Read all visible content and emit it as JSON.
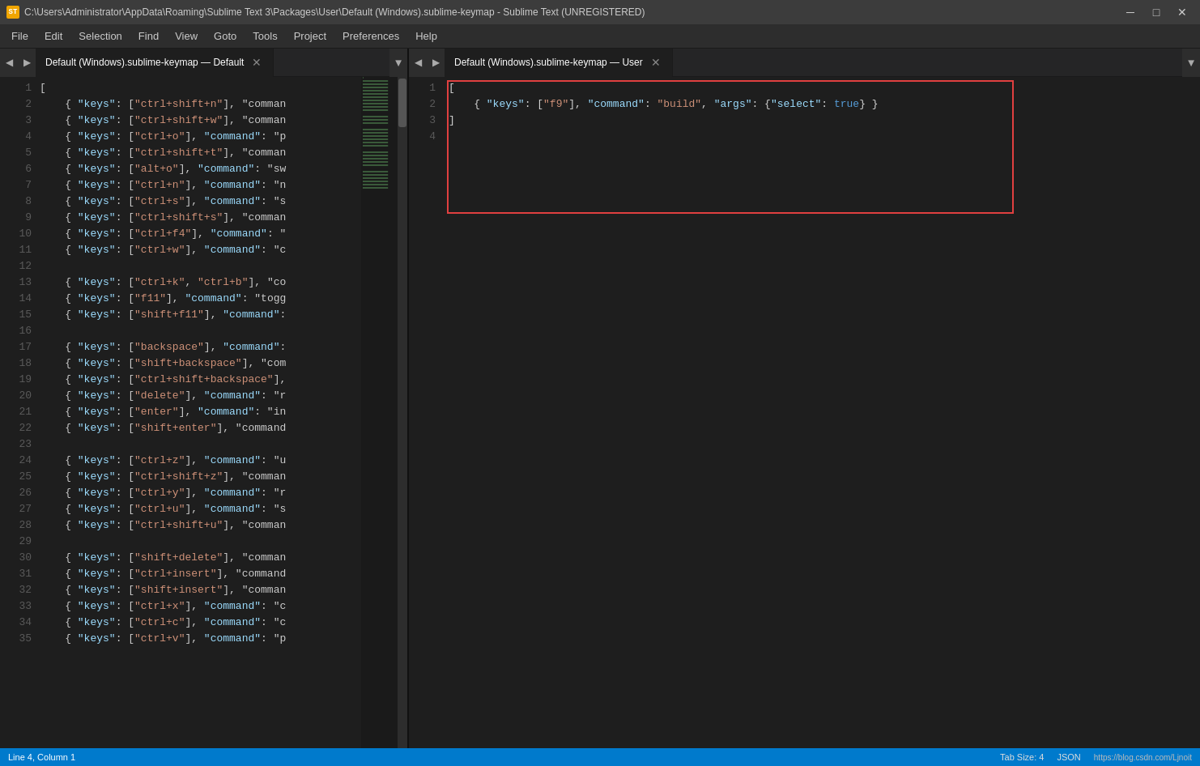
{
  "titlebar": {
    "icon": "ST",
    "text": "C:\\Users\\Administrator\\AppData\\Roaming\\Sublime Text 3\\Packages\\User\\Default (Windows).sublime-keymap - Sublime Text (UNREGISTERED)",
    "minimize": "─",
    "maximize": "□",
    "close": "✕"
  },
  "menubar": {
    "items": [
      "File",
      "Edit",
      "Selection",
      "Find",
      "View",
      "Goto",
      "Tools",
      "Project",
      "Preferences",
      "Help"
    ]
  },
  "left_pane": {
    "tab": {
      "label": "Default (Windows).sublime-keymap — Default",
      "close": "✕"
    },
    "lines": [
      {
        "num": "1",
        "code": "["
      },
      {
        "num": "2",
        "code": "    { \"keys\": [\"ctrl+shift+n\"], \"comman"
      },
      {
        "num": "3",
        "code": "    { \"keys\": [\"ctrl+shift+w\"], \"comman"
      },
      {
        "num": "4",
        "code": "    { \"keys\": [\"ctrl+o\"], \"command\": \"p"
      },
      {
        "num": "5",
        "code": "    { \"keys\": [\"ctrl+shift+t\"], \"comman"
      },
      {
        "num": "6",
        "code": "    { \"keys\": [\"alt+o\"], \"command\": \"sw"
      },
      {
        "num": "7",
        "code": "    { \"keys\": [\"ctrl+n\"], \"command\": \"n"
      },
      {
        "num": "8",
        "code": "    { \"keys\": [\"ctrl+s\"], \"command\": \"s"
      },
      {
        "num": "9",
        "code": "    { \"keys\": [\"ctrl+shift+s\"], \"comman"
      },
      {
        "num": "10",
        "code": "    { \"keys\": [\"ctrl+f4\"], \"command\": \""
      },
      {
        "num": "11",
        "code": "    { \"keys\": [\"ctrl+w\"], \"command\": \"c"
      },
      {
        "num": "12",
        "code": ""
      },
      {
        "num": "13",
        "code": "    { \"keys\": [\"ctrl+k\", \"ctrl+b\"], \"co"
      },
      {
        "num": "14",
        "code": "    { \"keys\": [\"f11\"], \"command\": \"togg"
      },
      {
        "num": "15",
        "code": "    { \"keys\": [\"shift+f11\"], \"command\":"
      },
      {
        "num": "16",
        "code": ""
      },
      {
        "num": "17",
        "code": "    { \"keys\": [\"backspace\"], \"command\":"
      },
      {
        "num": "18",
        "code": "    { \"keys\": [\"shift+backspace\"], \"com"
      },
      {
        "num": "19",
        "code": "    { \"keys\": [\"ctrl+shift+backspace\"],"
      },
      {
        "num": "20",
        "code": "    { \"keys\": [\"delete\"], \"command\": \"r"
      },
      {
        "num": "21",
        "code": "    { \"keys\": [\"enter\"], \"command\": \"in"
      },
      {
        "num": "22",
        "code": "    { \"keys\": [\"shift+enter\"], \"command"
      },
      {
        "num": "23",
        "code": ""
      },
      {
        "num": "24",
        "code": "    { \"keys\": [\"ctrl+z\"], \"command\": \"u"
      },
      {
        "num": "25",
        "code": "    { \"keys\": [\"ctrl+shift+z\"], \"comman"
      },
      {
        "num": "26",
        "code": "    { \"keys\": [\"ctrl+y\"], \"command\": \"r"
      },
      {
        "num": "27",
        "code": "    { \"keys\": [\"ctrl+u\"], \"command\": \"s"
      },
      {
        "num": "28",
        "code": "    { \"keys\": [\"ctrl+shift+u\"], \"comman"
      },
      {
        "num": "29",
        "code": ""
      },
      {
        "num": "30",
        "code": "    { \"keys\": [\"shift+delete\"], \"comman"
      },
      {
        "num": "31",
        "code": "    { \"keys\": [\"ctrl+insert\"], \"command"
      },
      {
        "num": "32",
        "code": "    { \"keys\": [\"shift+insert\"], \"comman"
      },
      {
        "num": "33",
        "code": "    { \"keys\": [\"ctrl+x\"], \"command\": \"c"
      },
      {
        "num": "34",
        "code": "    { \"keys\": [\"ctrl+c\"], \"command\": \"c"
      },
      {
        "num": "35",
        "code": "    { \"keys\": [\"ctrl+v\"], \"command\": \"p"
      }
    ]
  },
  "right_pane": {
    "tab": {
      "label": "Default (Windows).sublime-keymap — User",
      "close": "✕"
    },
    "lines": [
      {
        "num": "1",
        "code_parts": [
          {
            "text": "[",
            "class": "s-bracket"
          }
        ]
      },
      {
        "num": "2",
        "code_parts": [
          {
            "text": "    { ",
            "class": ""
          },
          {
            "text": "\"keys\"",
            "class": "s-key"
          },
          {
            "text": ": [",
            "class": ""
          },
          {
            "text": "\"f9\"",
            "class": "s-string"
          },
          {
            "text": "], ",
            "class": ""
          },
          {
            "text": "\"command\"",
            "class": "s-key"
          },
          {
            "text": ": ",
            "class": ""
          },
          {
            "text": "\"build\"",
            "class": "s-string"
          },
          {
            "text": ", ",
            "class": ""
          },
          {
            "text": "\"args\"",
            "class": "s-key"
          },
          {
            "text": ": {",
            "class": ""
          },
          {
            "text": "\"select\"",
            "class": "s-key"
          },
          {
            "text": ": ",
            "class": ""
          },
          {
            "text": "true",
            "class": "s-bool"
          },
          {
            "text": "} }",
            "class": ""
          }
        ]
      },
      {
        "num": "3",
        "code_parts": [
          {
            "text": "]",
            "class": "s-bracket"
          }
        ]
      },
      {
        "num": "4",
        "code_parts": [
          {
            "text": "",
            "class": ""
          }
        ]
      }
    ]
  },
  "status_bar": {
    "left": {
      "position": "Line 4, Column 1"
    },
    "right": {
      "tab_size": "Tab Size: 4",
      "syntax": "JSON",
      "url": "https://blog.csdn.com/Ljnoit"
    }
  }
}
